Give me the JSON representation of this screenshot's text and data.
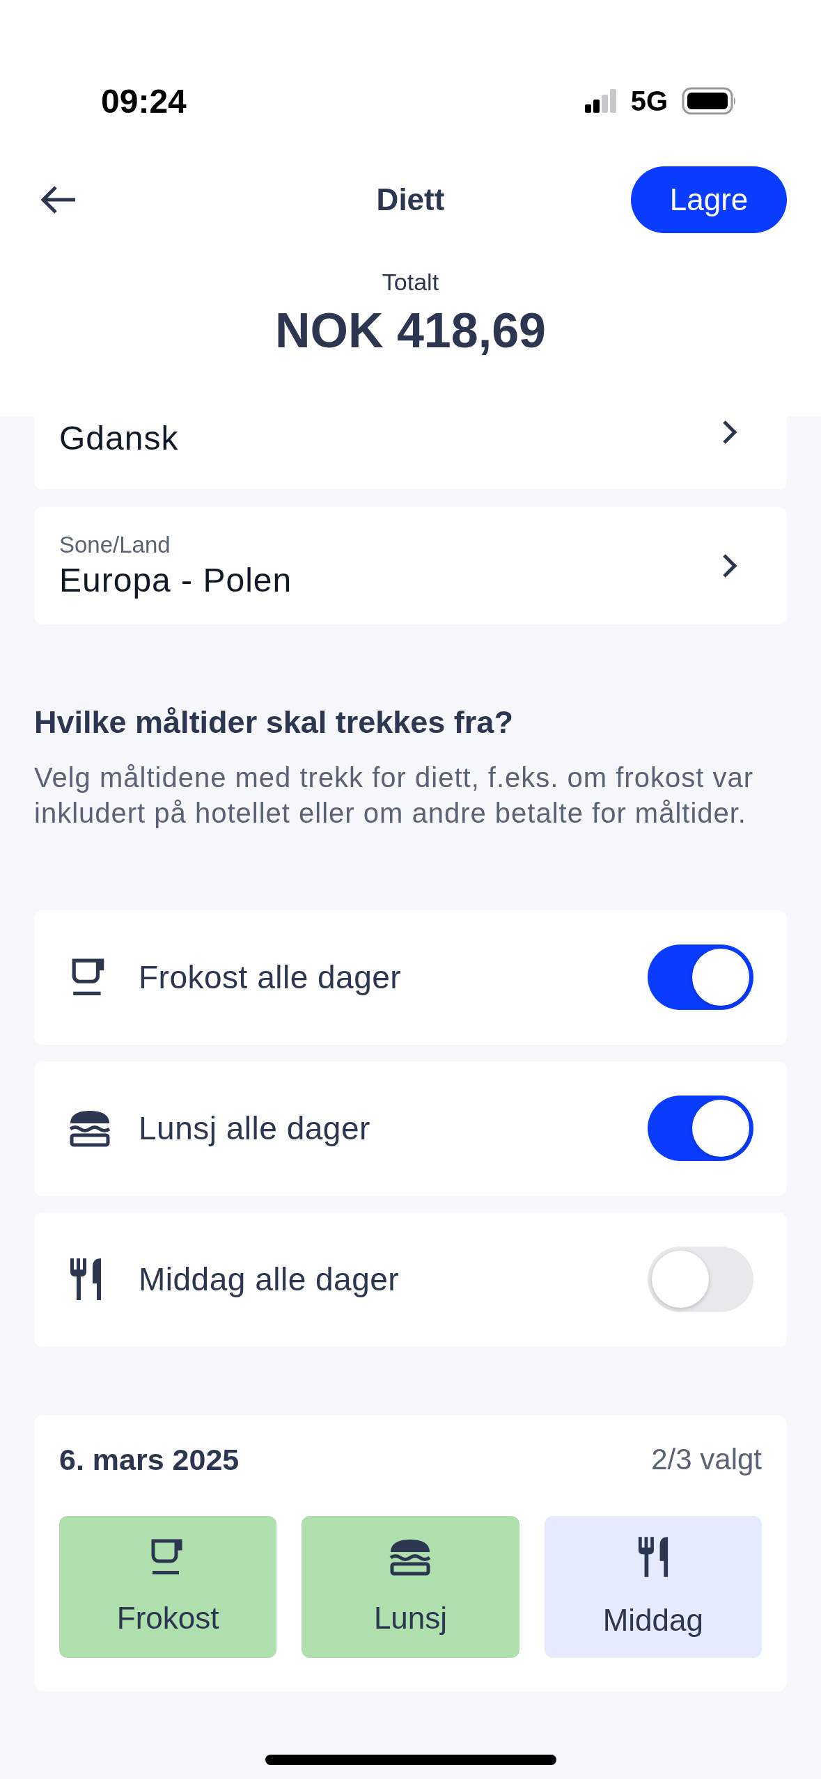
{
  "status_bar": {
    "time": "09:24",
    "network": "5G"
  },
  "header": {
    "title": "Diett",
    "save_button": "Lagre",
    "total_label": "Totalt",
    "total_value": "NOK 418,69"
  },
  "fields": [
    {
      "value": "Gdansk"
    },
    {
      "label": "Sone/Land",
      "value": "Europa - Polen"
    }
  ],
  "meals_section": {
    "heading": "Hvilke måltider skal trekkes fra?",
    "description": "Velg måltidene med trekk for diett, f.eks. om frokost var inkludert på hotellet eller om andre betalte for måltider."
  },
  "meal_toggles": [
    {
      "kind": "breakfast",
      "label": "Frokost alle dager",
      "on": true
    },
    {
      "kind": "lunch",
      "label": "Lunsj alle dager",
      "on": true
    },
    {
      "kind": "dinner",
      "label": "Middag alle dager",
      "on": false
    }
  ],
  "days": [
    {
      "date": "6. mars 2025",
      "count": "2/3 valgt",
      "meals": [
        {
          "kind": "breakfast",
          "label": "Frokost",
          "selected": true
        },
        {
          "kind": "lunch",
          "label": "Lunsj",
          "selected": true
        },
        {
          "kind": "dinner",
          "label": "Middag",
          "selected": false
        }
      ]
    }
  ]
}
